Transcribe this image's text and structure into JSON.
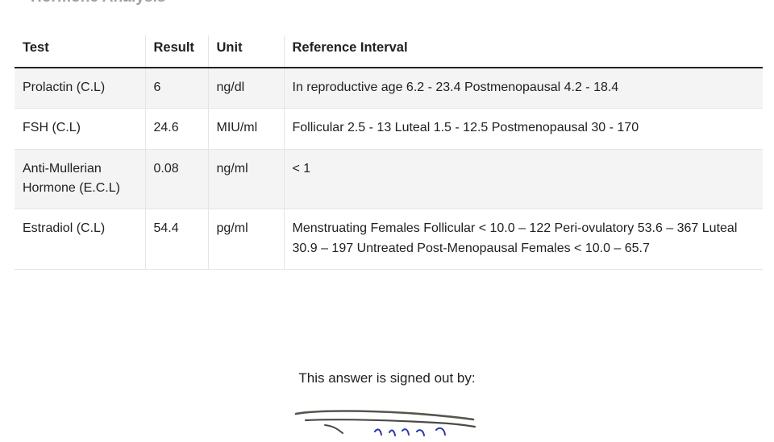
{
  "page": {
    "title": "Hormone Analysis"
  },
  "table": {
    "headers": {
      "test": "Test",
      "result": "Result",
      "unit": "Unit",
      "reference": "Reference Interval"
    },
    "rows": [
      {
        "test": "Prolactin (C.L)",
        "result": "6",
        "unit": "ng/dl",
        "reference": "In reproductive age 6.2 - 23.4 Postmenopausal 4.2 - 18.4"
      },
      {
        "test": "FSH (C.L)",
        "result": "24.6",
        "unit": "MIU/ml",
        "reference": "Follicular 2.5 - 13 Luteal 1.5 - 12.5 Postmenopausal 30 - 170"
      },
      {
        "test": "Anti-Mullerian Hormone (E.C.L)",
        "result": "0.08",
        "unit": "ng/ml",
        "reference": "< 1"
      },
      {
        "test": "Estradiol (C.L)",
        "result": "54.4",
        "unit": "pg/ml",
        "reference": "Menstruating Females Follicular < 10.0 – 122 Peri-ovulatory 53.6 – 367 Luteal 30.9 – 197 Untreated Post-Menopausal Females < 10.0 – 65.7"
      }
    ]
  },
  "signature": {
    "label": "This answer is signed out by:",
    "image_name": "handwritten-signature"
  },
  "colors": {
    "text": "#202124",
    "title_muted": "#9aa0a6",
    "row_alt_background": "#f4f4f4",
    "row_background": "#ffffff",
    "header_rule": "#202124",
    "row_rule": "#e3e5e8",
    "signature_ink_dark": "#4a4a46",
    "signature_ink_blue": "#2c39a8"
  }
}
